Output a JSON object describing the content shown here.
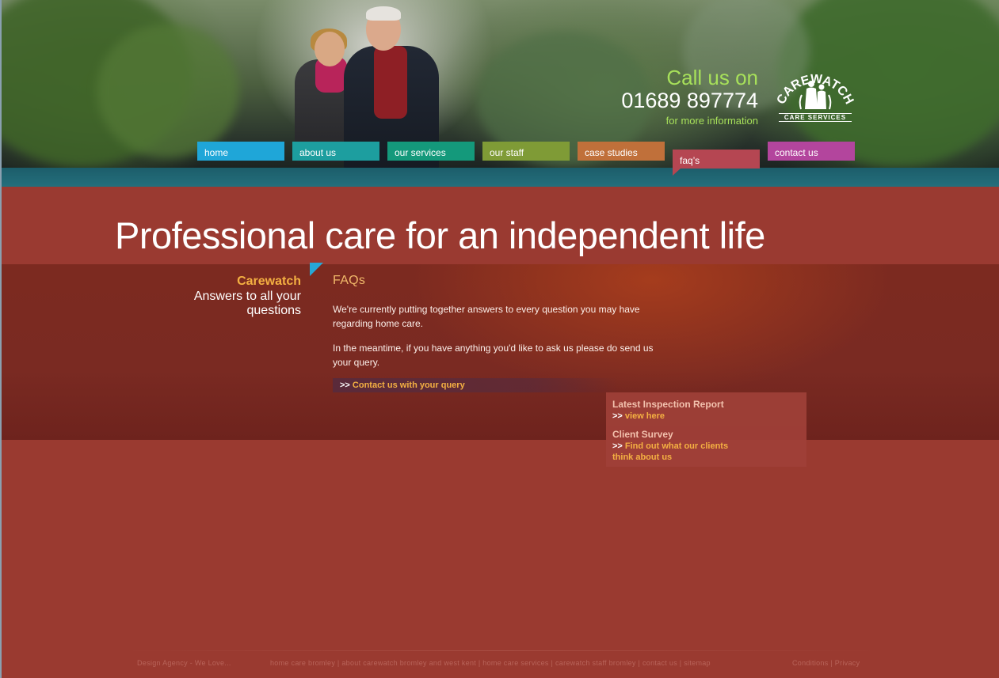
{
  "header": {
    "call_line1": "Call us on",
    "phone": "01689 897774",
    "more_info": "for more information",
    "logo_text": "CAREWATCH",
    "logo_sub": "CARE SERVICES"
  },
  "nav": [
    {
      "label": "home",
      "color": "#1fa6d8"
    },
    {
      "label": "about us",
      "color": "#1d9e9f"
    },
    {
      "label": "our services",
      "color": "#14997b"
    },
    {
      "label": "our staff",
      "color": "#7f9b36"
    },
    {
      "label": "case studies",
      "color": "#c0703a"
    },
    {
      "label": "faq’s",
      "color": "#b54652",
      "active": true
    },
    {
      "label": "contact us",
      "color": "#b3459d"
    }
  ],
  "page_title": "Professional care for an independent life",
  "sidebar": {
    "title": "Carewatch",
    "subtitle": "Answers to all your questions"
  },
  "main": {
    "heading": "FAQs",
    "paragraphs": [
      "We're currently putting together answers to every question you may have regarding home care.",
      "In the meantime, if you have anything you'd like to ask us please do send us your query."
    ],
    "cta_prefix": ">> ",
    "cta_link": "Contact us with your query"
  },
  "infobox": {
    "report_heading": "Latest Inspection Report",
    "report_prefix": ">> ",
    "report_link": "view here",
    "survey_heading": "Client Survey",
    "survey_prefix": ">> ",
    "survey_link": "Find out what our clients think about us"
  },
  "footer": {
    "agency": "Design Agency - We Love...",
    "links": "home care bromley | about carewatch bromley and west kent | home care services | carewatch staff bromley | contact us | sitemap",
    "legal": "Conditions | Privacy"
  }
}
